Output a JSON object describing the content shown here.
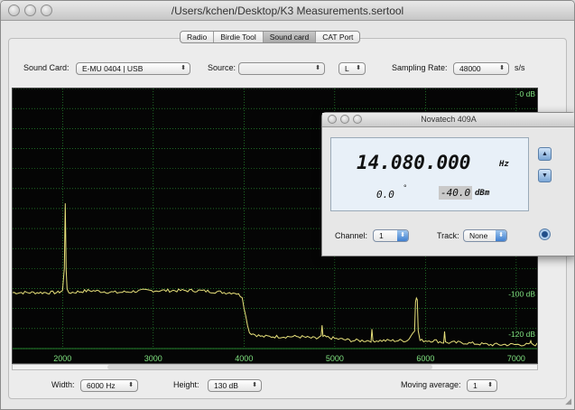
{
  "window": {
    "title": "/Users/kchen/Desktop/K3 Measurements.sertool"
  },
  "tabs": [
    {
      "label": "Radio",
      "active": false
    },
    {
      "label": "Birdie Tool",
      "active": false
    },
    {
      "label": "Sound card",
      "active": true
    },
    {
      "label": "CAT Port",
      "active": false
    }
  ],
  "controls": {
    "sound_card_label": "Sound Card:",
    "sound_card_value": "E-MU 0404 | USB",
    "source_label": "Source:",
    "source_value": "",
    "channel_value": "L",
    "sampling_rate_label": "Sampling Rate:",
    "sampling_rate_value": "48000",
    "sampling_rate_unit": "s/s"
  },
  "bottom": {
    "width_label": "Width:",
    "width_value": "6000 Hz",
    "height_label": "Height:",
    "height_value": "130 dB",
    "moving_average_label": "Moving average:",
    "moving_average_value": "1"
  },
  "novatech": {
    "title": "Novatech 409A",
    "frequency": "14.080.000",
    "frequency_unit": "Hz",
    "phase": "0.0",
    "phase_unit": "°",
    "amplitude": "-40.0",
    "amplitude_unit": "dBm",
    "channel_label": "Channel:",
    "channel_value": "1",
    "track_label": "Track:",
    "track_value": "None"
  },
  "colors": {
    "plot_background": "#050505",
    "grid": "#2fa83a",
    "trace": "#e7e07a",
    "axis_labels": "#7fe07f"
  },
  "chart_data": {
    "type": "line",
    "title": "",
    "xlabel": "",
    "ylabel": "",
    "xlim": [
      1450,
      7250
    ],
    "ylim": [
      -130,
      0
    ],
    "x_ticks": [
      2000,
      3000,
      4000,
      5000,
      6000,
      7000
    ],
    "x_tick_labels": [
      "2000",
      "3000",
      "4000",
      "5000",
      "6000",
      "7000"
    ],
    "y_ticks": [
      0,
      -100,
      -120
    ],
    "y_tick_labels": [
      "-0 dB",
      "-100 dB",
      "-120 dB"
    ],
    "grid": true,
    "series": [
      {
        "x": [
          1450,
          1700,
          1950,
          2000,
          2020,
          2030,
          2040,
          2050,
          2070,
          2090,
          2300,
          2600,
          2900,
          3200,
          3500,
          3800,
          3900,
          3980,
          4020,
          4060,
          4120,
          4200,
          4400,
          4600,
          4800,
          4850,
          4860,
          4870,
          5000,
          5200,
          5400,
          5410,
          5420,
          5600,
          5800,
          5880,
          5890,
          5900,
          5910,
          5920,
          5940,
          6000,
          6100,
          6200,
          6210,
          6220,
          6400,
          6700,
          7000,
          7150,
          7160,
          7170,
          7250
        ],
        "y": [
          -102,
          -102,
          -102,
          -101,
          -90,
          -57,
          -90,
          -101,
          -102,
          -102,
          -101,
          -102,
          -101,
          -101,
          -101,
          -102,
          -102,
          -104,
          -114,
          -122,
          -123,
          -124,
          -124,
          -124,
          -125,
          -124,
          -119,
          -124,
          -125,
          -126,
          -126,
          -121,
          -126,
          -126,
          -126,
          -121,
          -106,
          -104,
          -106,
          -121,
          -126,
          -126,
          -126,
          -127,
          -121,
          -127,
          -127,
          -128,
          -128,
          -128,
          -126,
          -128,
          -128
        ]
      }
    ]
  }
}
